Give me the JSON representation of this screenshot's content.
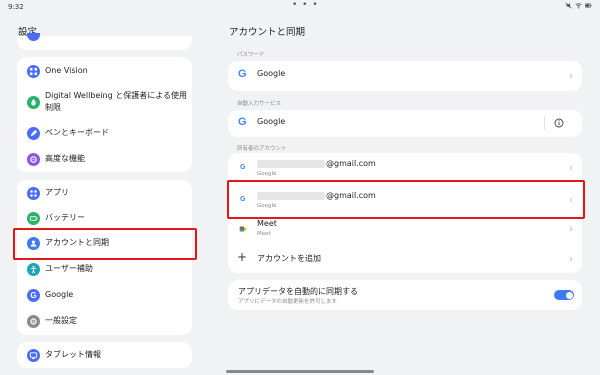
{
  "status": {
    "time": "9:32",
    "dots": "• • •"
  },
  "left": {
    "title": "設定",
    "group1": [
      {
        "label": "One Vision",
        "icon": "one-vision-icon",
        "color": "#4a6cf7"
      },
      {
        "label": "Digital Wellbeing と保護者による使用",
        "label2": "制限",
        "icon": "wellbeing-icon",
        "color": "#28b36a"
      },
      {
        "label": "ペンとキーボード",
        "icon": "pen-icon",
        "color": "#4a6cf7"
      },
      {
        "label": "高度な機能",
        "icon": "advanced-icon",
        "color": "#8b55e6"
      }
    ],
    "group2": [
      {
        "label": "アプリ",
        "icon": "apps-icon",
        "color": "#4a6cf7"
      },
      {
        "label": "バッテリー",
        "icon": "battery-icon",
        "color": "#28b36a"
      },
      {
        "label": "アカウントと同期",
        "icon": "account-icon",
        "color": "#3f7bf0"
      },
      {
        "label": "ユーザー補助",
        "icon": "accessibility-icon",
        "color": "#19a7b8"
      },
      {
        "label": "Google",
        "icon": "google-icon",
        "color": "#4a6cf7"
      },
      {
        "label": "一般設定",
        "icon": "general-settings-icon",
        "color": "#8a8a8a"
      }
    ],
    "group3": [
      {
        "label": "タブレット情報",
        "icon": "tablet-info-icon",
        "color": "#4a6cf7"
      }
    ]
  },
  "right": {
    "title": "アカウントと同期",
    "password_section": "パスワード",
    "password_item": "Google",
    "autofill_section": "自動入力サービス",
    "autofill_item": "Google",
    "owner_section": "所有者のアカウント",
    "accounts": [
      {
        "email": "@gmail.com",
        "sub": "Google"
      },
      {
        "email": "@gmail.com",
        "sub": "Google"
      },
      {
        "email": "Meet",
        "sub": "Meet"
      }
    ],
    "add_account": "アカウントを追加",
    "sync_title": "アプリデータを自動的に同期する",
    "sync_sub": "アプリにデータの自動更新を許可します",
    "sync_enabled": true
  },
  "colors": {
    "accent": "#3f7bf0",
    "highlight": "#e01818"
  }
}
